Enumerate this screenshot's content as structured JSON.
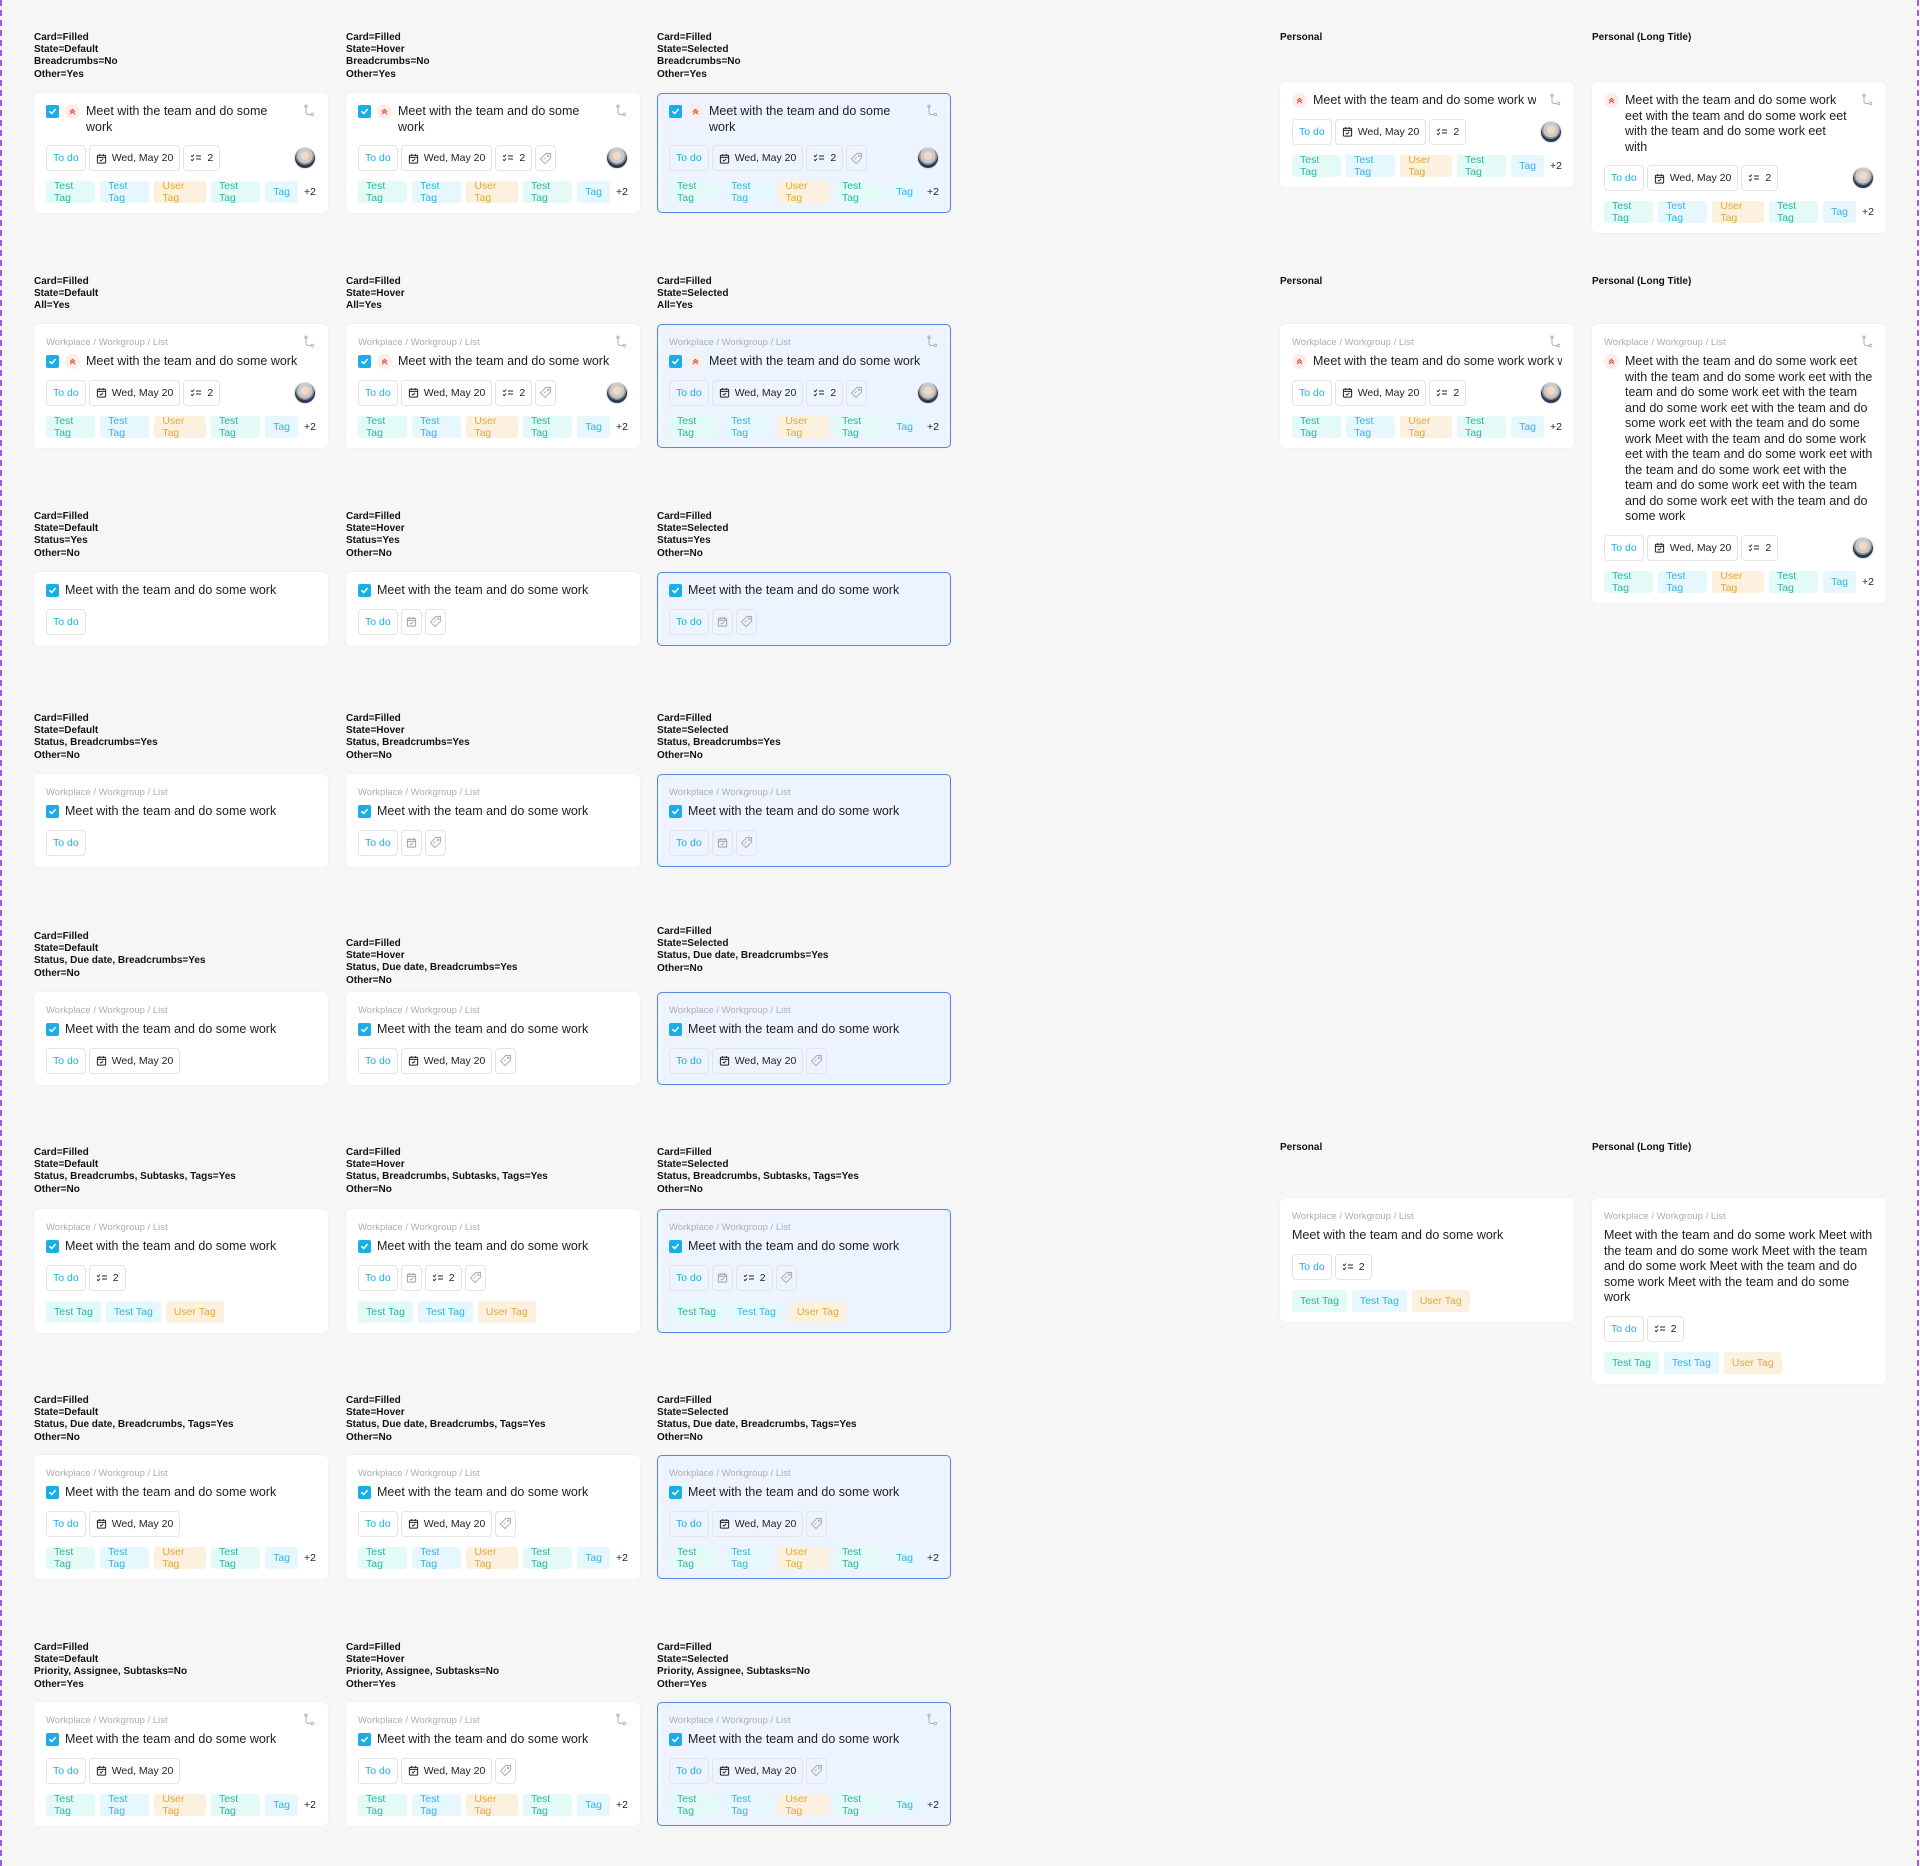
{
  "common": {
    "breadcrumb": "Workplace / Workgroup / List",
    "title": "Meet with the team and do some work",
    "status": "To do",
    "due_date": "Wed, May 20",
    "subtasks_count": "2",
    "overflow_count": "+2"
  },
  "colors": {
    "accent": "#1AAEE5",
    "selected_border": "#5B86E5",
    "selected_bg": "#EEF4FF",
    "priority": "#D9503C",
    "tag_teal": "#2DB5A0",
    "tag_blue": "#38B2E6",
    "tag_orange": "#E5A83B",
    "frame_dash": "#A35BE8"
  },
  "tags_full": [
    {
      "label": "Test Tag",
      "color": "teal"
    },
    {
      "label": "Test Tag",
      "color": "blue"
    },
    {
      "label": "User Tag",
      "color": "orange"
    },
    {
      "label": "Test Tag",
      "color": "teal"
    },
    {
      "label": "Tag",
      "color": "blue"
    }
  ],
  "tags_short": [
    {
      "label": "Test Tag",
      "color": "teal"
    },
    {
      "label": "Test Tag",
      "color": "blue"
    },
    {
      "label": "User Tag",
      "color": "orange"
    }
  ],
  "variants": [
    {
      "label": "Card=Filled\nState=Default\nBreadcrumbs=No\nOther=Yes",
      "state": "default",
      "breadcrumb": false,
      "checkbox": true,
      "priority": true,
      "subtask_icon": true,
      "date": true,
      "date_icon_only": false,
      "subtasks": true,
      "tag_button": false,
      "assignee": true,
      "tags": "full"
    },
    {
      "label": "Card=Filled\nState=Hover\nBreadcrumbs=No\nOther=Yes",
      "state": "hover",
      "breadcrumb": false,
      "checkbox": true,
      "priority": true,
      "subtask_icon": true,
      "date": true,
      "date_icon_only": false,
      "subtasks": true,
      "tag_button": true,
      "assignee": true,
      "tags": "full"
    },
    {
      "label": "Card=Filled\nState=Selected\nBreadcrumbs=No\nOther=Yes",
      "state": "selected",
      "breadcrumb": false,
      "checkbox": true,
      "priority": true,
      "subtask_icon": true,
      "date": true,
      "date_icon_only": false,
      "subtasks": true,
      "tag_button": true,
      "assignee": true,
      "tags": "full"
    },
    {
      "label": "Personal",
      "state": "default",
      "breadcrumb": false,
      "checkbox": false,
      "priority": true,
      "subtask_icon": true,
      "date": true,
      "date_icon_only": false,
      "subtasks": true,
      "tag_button": false,
      "assignee": true,
      "tags": "full",
      "title": "Meet with the team and do some work wor",
      "nowrap": true
    },
    {
      "label": "Personal (Long Title)",
      "state": "default",
      "breadcrumb": false,
      "checkbox": false,
      "priority": true,
      "subtask_icon": true,
      "date": true,
      "date_icon_only": false,
      "subtasks": true,
      "tag_button": false,
      "assignee": true,
      "tags": "full",
      "title": "Meet with the team and do some work eet with the team and do some work eet with the team and do some work eet with"
    },
    {
      "label": "Card=Filled\nState=Default\nAll=Yes",
      "state": "default",
      "breadcrumb": true,
      "checkbox": true,
      "priority": true,
      "subtask_icon": true,
      "date": true,
      "date_icon_only": false,
      "subtasks": true,
      "tag_button": false,
      "assignee": true,
      "tags": "full"
    },
    {
      "label": "Card=Filled\nState=Hover\nAll=Yes",
      "state": "hover",
      "breadcrumb": true,
      "checkbox": true,
      "priority": true,
      "subtask_icon": true,
      "date": true,
      "date_icon_only": false,
      "subtasks": true,
      "tag_button": true,
      "assignee": true,
      "tags": "full"
    },
    {
      "label": "Card=Filled\nState=Selected\nAll=Yes",
      "state": "selected",
      "breadcrumb": true,
      "checkbox": true,
      "priority": true,
      "subtask_icon": true,
      "date": true,
      "date_icon_only": false,
      "subtasks": true,
      "tag_button": true,
      "assignee": true,
      "tags": "full"
    },
    {
      "label": "Personal",
      "state": "default",
      "breadcrumb": true,
      "checkbox": false,
      "priority": true,
      "subtask_icon": true,
      "date": true,
      "date_icon_only": false,
      "subtasks": true,
      "tag_button": false,
      "assignee": true,
      "tags": "full",
      "title": "Meet with the team and do some work work wo",
      "nowrap": true
    },
    {
      "label": "Personal (Long Title)",
      "state": "default",
      "breadcrumb": true,
      "checkbox": false,
      "priority": true,
      "subtask_icon": true,
      "date": true,
      "date_icon_only": false,
      "subtasks": true,
      "tag_button": false,
      "assignee": true,
      "tags": "full",
      "title": "Meet with the team and do some work eet with the team and do some work eet with the team and do some work eet with the team and do some work eet with the team and do some work eet with the team and do some work Meet with the team and do some work eet with the team and do some work eet with the team and do some work eet with the team and do some work eet with the team and do some work eet with the team and do some work"
    },
    {
      "label": "Card=Filled\nState=Default\nStatus=Yes\nOther=No",
      "state": "default",
      "breadcrumb": false,
      "checkbox": true,
      "priority": false,
      "subtask_icon": false,
      "date": false,
      "date_icon_only": false,
      "subtasks": false,
      "tag_button": false,
      "assignee": false,
      "tags": "none"
    },
    {
      "label": "Card=Filled\nState=Hover\nStatus=Yes\nOther=No",
      "state": "hover",
      "breadcrumb": false,
      "checkbox": true,
      "priority": false,
      "subtask_icon": false,
      "date": true,
      "date_icon_only": true,
      "subtasks": false,
      "tag_button": true,
      "assignee": false,
      "tags": "none"
    },
    {
      "label": "Card=Filled\nState=Selected\nStatus=Yes\nOther=No",
      "state": "selected",
      "breadcrumb": false,
      "checkbox": true,
      "priority": false,
      "subtask_icon": false,
      "date": true,
      "date_icon_only": true,
      "subtasks": false,
      "tag_button": true,
      "assignee": false,
      "tags": "none"
    },
    {
      "label": "Card=Filled\nState=Default\nStatus, Breadcrumbs=Yes\nOther=No",
      "state": "default",
      "breadcrumb": true,
      "checkbox": true,
      "priority": false,
      "subtask_icon": false,
      "date": false,
      "date_icon_only": false,
      "subtasks": false,
      "tag_button": false,
      "assignee": false,
      "tags": "none"
    },
    {
      "label": "Card=Filled\nState=Hover\nStatus, Breadcrumbs=Yes\nOther=No",
      "state": "hover",
      "breadcrumb": true,
      "checkbox": true,
      "priority": false,
      "subtask_icon": false,
      "date": true,
      "date_icon_only": true,
      "subtasks": false,
      "tag_button": true,
      "assignee": false,
      "tags": "none"
    },
    {
      "label": "Card=Filled\nState=Selected\nStatus, Breadcrumbs=Yes\nOther=No",
      "state": "selected",
      "breadcrumb": true,
      "checkbox": true,
      "priority": false,
      "subtask_icon": false,
      "date": true,
      "date_icon_only": true,
      "subtasks": false,
      "tag_button": true,
      "assignee": false,
      "tags": "none"
    },
    {
      "label": "Card=Filled\nState=Default\nStatus, Due date, Breadcrumbs=Yes\nOther=No",
      "state": "default",
      "breadcrumb": true,
      "checkbox": true,
      "priority": false,
      "subtask_icon": false,
      "date": true,
      "date_icon_only": false,
      "subtasks": false,
      "tag_button": false,
      "assignee": false,
      "tags": "none"
    },
    {
      "label": "Card=Filled\nState=Hover\nStatus, Due date, Breadcrumbs=Yes\nOther=No",
      "state": "hover",
      "breadcrumb": true,
      "checkbox": true,
      "priority": false,
      "subtask_icon": false,
      "date": true,
      "date_icon_only": false,
      "subtasks": false,
      "tag_button": true,
      "assignee": false,
      "tags": "none"
    },
    {
      "label": "Card=Filled\nState=Selected\nStatus, Due date, Breadcrumbs=Yes\nOther=No",
      "state": "selected",
      "breadcrumb": true,
      "checkbox": true,
      "priority": false,
      "subtask_icon": false,
      "date": true,
      "date_icon_only": false,
      "subtasks": false,
      "tag_button": true,
      "assignee": false,
      "tags": "none"
    },
    {
      "label": "Card=Filled\nState=Default\nStatus, Breadcrumbs, Subtasks, Tags=Yes\nOther=No",
      "state": "default",
      "breadcrumb": true,
      "checkbox": true,
      "priority": false,
      "subtask_icon": false,
      "date": false,
      "date_icon_only": false,
      "subtasks": true,
      "tag_button": false,
      "assignee": false,
      "tags": "short"
    },
    {
      "label": "Card=Filled\nState=Hover\nStatus, Breadcrumbs, Subtasks, Tags=Yes\nOther=No",
      "state": "hover",
      "breadcrumb": true,
      "checkbox": true,
      "priority": false,
      "subtask_icon": false,
      "date": true,
      "date_icon_only": true,
      "subtasks": true,
      "tag_button": true,
      "assignee": false,
      "tags": "short"
    },
    {
      "label": "Card=Filled\nState=Selected\nStatus, Breadcrumbs, Subtasks, Tags=Yes\nOther=No",
      "state": "selected",
      "breadcrumb": true,
      "checkbox": true,
      "priority": false,
      "subtask_icon": false,
      "date": true,
      "date_icon_only": true,
      "subtasks": true,
      "tag_button": true,
      "assignee": false,
      "tags": "short"
    },
    {
      "label": "Personal",
      "state": "default",
      "breadcrumb": true,
      "checkbox": false,
      "priority": false,
      "subtask_icon": false,
      "date": false,
      "date_icon_only": false,
      "subtasks": true,
      "tag_button": false,
      "assignee": false,
      "tags": "short"
    },
    {
      "label": "Personal (Long Title)",
      "state": "default",
      "breadcrumb": true,
      "checkbox": false,
      "priority": false,
      "subtask_icon": false,
      "date": false,
      "date_icon_only": false,
      "subtasks": true,
      "tag_button": false,
      "assignee": false,
      "tags": "short",
      "title": "Meet with the team and do some work Meet with the team and do some work Meet with the team and do some work Meet with the team and do some work Meet with the team and do some work"
    },
    {
      "label": "Card=Filled\nState=Default\nStatus, Due date, Breadcrumbs, Tags=Yes\nOther=No",
      "state": "default",
      "breadcrumb": true,
      "checkbox": true,
      "priority": false,
      "subtask_icon": false,
      "date": true,
      "date_icon_only": false,
      "subtasks": false,
      "tag_button": false,
      "assignee": false,
      "tags": "full"
    },
    {
      "label": "Card=Filled\nState=Hover\nStatus, Due date, Breadcrumbs, Tags=Yes\nOther=No",
      "state": "hover",
      "breadcrumb": true,
      "checkbox": true,
      "priority": false,
      "subtask_icon": false,
      "date": true,
      "date_icon_only": false,
      "subtasks": false,
      "tag_button": true,
      "assignee": false,
      "tags": "full"
    },
    {
      "label": "Card=Filled\nState=Selected\nStatus, Due date, Breadcrumbs, Tags=Yes\nOther=No",
      "state": "selected",
      "breadcrumb": true,
      "checkbox": true,
      "priority": false,
      "subtask_icon": false,
      "date": true,
      "date_icon_only": false,
      "subtasks": false,
      "tag_button": true,
      "assignee": false,
      "tags": "full"
    },
    {
      "label": "Card=Filled\nState=Default\nPriority, Assignee, Subtasks=No\nOther=Yes",
      "state": "default",
      "breadcrumb": true,
      "checkbox": true,
      "priority": false,
      "subtask_icon": true,
      "date": true,
      "date_icon_only": false,
      "subtasks": false,
      "tag_button": false,
      "assignee": false,
      "tags": "full"
    },
    {
      "label": "Card=Filled\nState=Hover\nPriority, Assignee, Subtasks=No\nOther=Yes",
      "state": "hover",
      "breadcrumb": true,
      "checkbox": true,
      "priority": false,
      "subtask_icon": true,
      "date": true,
      "date_icon_only": false,
      "subtasks": false,
      "tag_button": true,
      "assignee": false,
      "tags": "full"
    },
    {
      "label": "Card=Filled\nState=Selected\nPriority, Assignee, Subtasks=No\nOther=Yes",
      "state": "selected",
      "breadcrumb": true,
      "checkbox": true,
      "priority": false,
      "subtask_icon": true,
      "date": true,
      "date_icon_only": false,
      "subtasks": false,
      "tag_button": true,
      "assignee": false,
      "tags": "full"
    }
  ]
}
